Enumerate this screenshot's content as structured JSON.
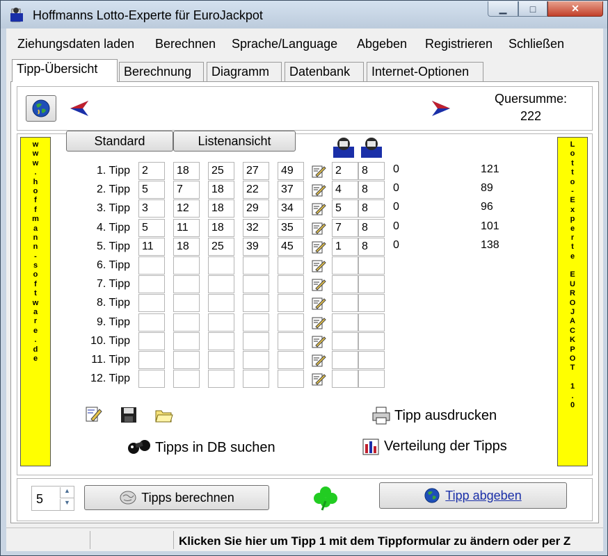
{
  "window": {
    "title": "Hoffmanns Lotto-Experte  für EuroJackpot",
    "minimize": "▁",
    "maximize": "□",
    "close": "✕"
  },
  "menu": [
    "Ziehungsdaten laden",
    "Berechnen",
    "Sprache/Language",
    "Abgeben",
    "Registrieren",
    "Schließen"
  ],
  "tabs": [
    "Tipp-Übersicht",
    "Berechnung",
    "Diagramm",
    "Datenbank",
    "Internet-Optionen"
  ],
  "active_tab": "Tipp-Übersicht",
  "quersumme": {
    "label": "Quersumme:",
    "value": "222"
  },
  "side_left_text": "www.hoffmann-software.de",
  "side_right_text": "Lotto-Experte EUROJACKPOT 1.0",
  "view_buttons": {
    "standard": "Standard",
    "list": "Listenansicht"
  },
  "tipps": [
    {
      "label": "1. Tipp",
      "numbers": [
        "2",
        "18",
        "25",
        "27",
        "49"
      ],
      "euro": [
        "2",
        "8"
      ],
      "hits": "0",
      "sum": "121"
    },
    {
      "label": "2. Tipp",
      "numbers": [
        "5",
        "7",
        "18",
        "22",
        "37"
      ],
      "euro": [
        "4",
        "8"
      ],
      "hits": "0",
      "sum": "89"
    },
    {
      "label": "3. Tipp",
      "numbers": [
        "3",
        "12",
        "18",
        "29",
        "34"
      ],
      "euro": [
        "5",
        "8"
      ],
      "hits": "0",
      "sum": "96"
    },
    {
      "label": "4. Tipp",
      "numbers": [
        "5",
        "11",
        "18",
        "32",
        "35"
      ],
      "euro": [
        "7",
        "8"
      ],
      "hits": "0",
      "sum": "101"
    },
    {
      "label": "5. Tipp",
      "numbers": [
        "11",
        "18",
        "25",
        "39",
        "45"
      ],
      "euro": [
        "1",
        "8"
      ],
      "hits": "0",
      "sum": "138"
    },
    {
      "label": "6. Tipp",
      "numbers": [
        "",
        "",
        "",
        "",
        ""
      ],
      "euro": [
        "",
        ""
      ],
      "hits": "",
      "sum": ""
    },
    {
      "label": "7. Tipp",
      "numbers": [
        "",
        "",
        "",
        "",
        ""
      ],
      "euro": [
        "",
        ""
      ],
      "hits": "",
      "sum": ""
    },
    {
      "label": "8. Tipp",
      "numbers": [
        "",
        "",
        "",
        "",
        ""
      ],
      "euro": [
        "",
        ""
      ],
      "hits": "",
      "sum": ""
    },
    {
      "label": "9. Tipp",
      "numbers": [
        "",
        "",
        "",
        "",
        ""
      ],
      "euro": [
        "",
        ""
      ],
      "hits": "",
      "sum": ""
    },
    {
      "label": "10. Tipp",
      "numbers": [
        "",
        "",
        "",
        "",
        ""
      ],
      "euro": [
        "",
        ""
      ],
      "hits": "",
      "sum": ""
    },
    {
      "label": "11. Tipp",
      "numbers": [
        "",
        "",
        "",
        "",
        ""
      ],
      "euro": [
        "",
        ""
      ],
      "hits": "",
      "sum": ""
    },
    {
      "label": "12. Tipp",
      "numbers": [
        "",
        "",
        "",
        "",
        ""
      ],
      "euro": [
        "",
        ""
      ],
      "hits": "",
      "sum": ""
    }
  ],
  "actions": {
    "print": "Tipp ausdrucken",
    "search_db": "Tipps in DB suchen",
    "distribution": "Verteilung der Tipps"
  },
  "bottom": {
    "count": "5",
    "calc_button": "Tipps berechnen",
    "submit_button": "Tipp abgeben"
  },
  "status": "Klicken Sie hier um Tipp 1 mit dem Tippformular zu ändern oder per Z",
  "colors": {
    "side_panel": "#ffff00",
    "arrow": "#1a2fa8",
    "clover": "#22cc22"
  }
}
